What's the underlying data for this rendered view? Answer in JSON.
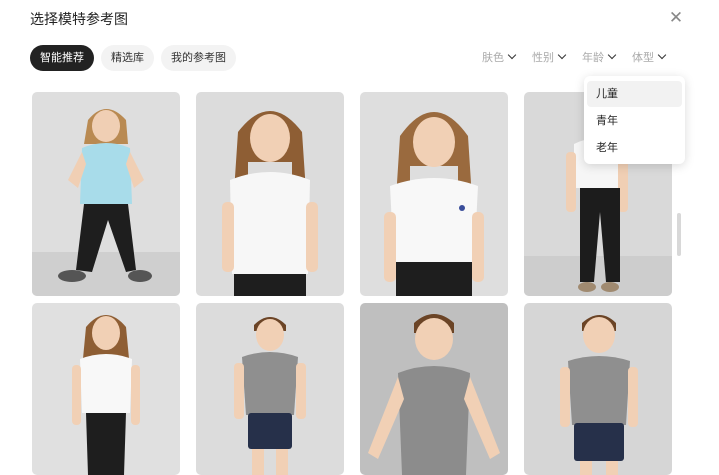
{
  "dialog": {
    "title": "选择模特参考图",
    "close_icon": "close-icon"
  },
  "tabs": [
    {
      "label": "智能推荐",
      "active": true
    },
    {
      "label": "精选库",
      "active": false
    },
    {
      "label": "我的参考图",
      "active": false
    }
  ],
  "filters": [
    {
      "label": "肤色"
    },
    {
      "label": "性别"
    },
    {
      "label": "年龄"
    },
    {
      "label": "体型"
    }
  ],
  "age_dropdown": {
    "options": [
      {
        "label": "儿童",
        "highlighted": true
      },
      {
        "label": "青年",
        "highlighted": false
      },
      {
        "label": "老年",
        "highlighted": false
      }
    ]
  },
  "images": [
    {
      "desc": "girl in light blue t-shirt and black leggings"
    },
    {
      "desc": "girl with long hair in white t-shirt"
    },
    {
      "desc": "girl in white t-shirt with small logo"
    },
    {
      "desc": "child in white t-shirt and black pants"
    },
    {
      "desc": "girl in white t-shirt and black leggings"
    },
    {
      "desc": "boy in grey t-shirt and navy shorts"
    },
    {
      "desc": "smiling boy in grey t-shirt"
    },
    {
      "desc": "boy in grey t-shirt and navy shorts"
    }
  ],
  "colors": {
    "accent": "#222222",
    "tab_bg": "#f3f3f3",
    "photo_bg": "#dcdcdc"
  }
}
